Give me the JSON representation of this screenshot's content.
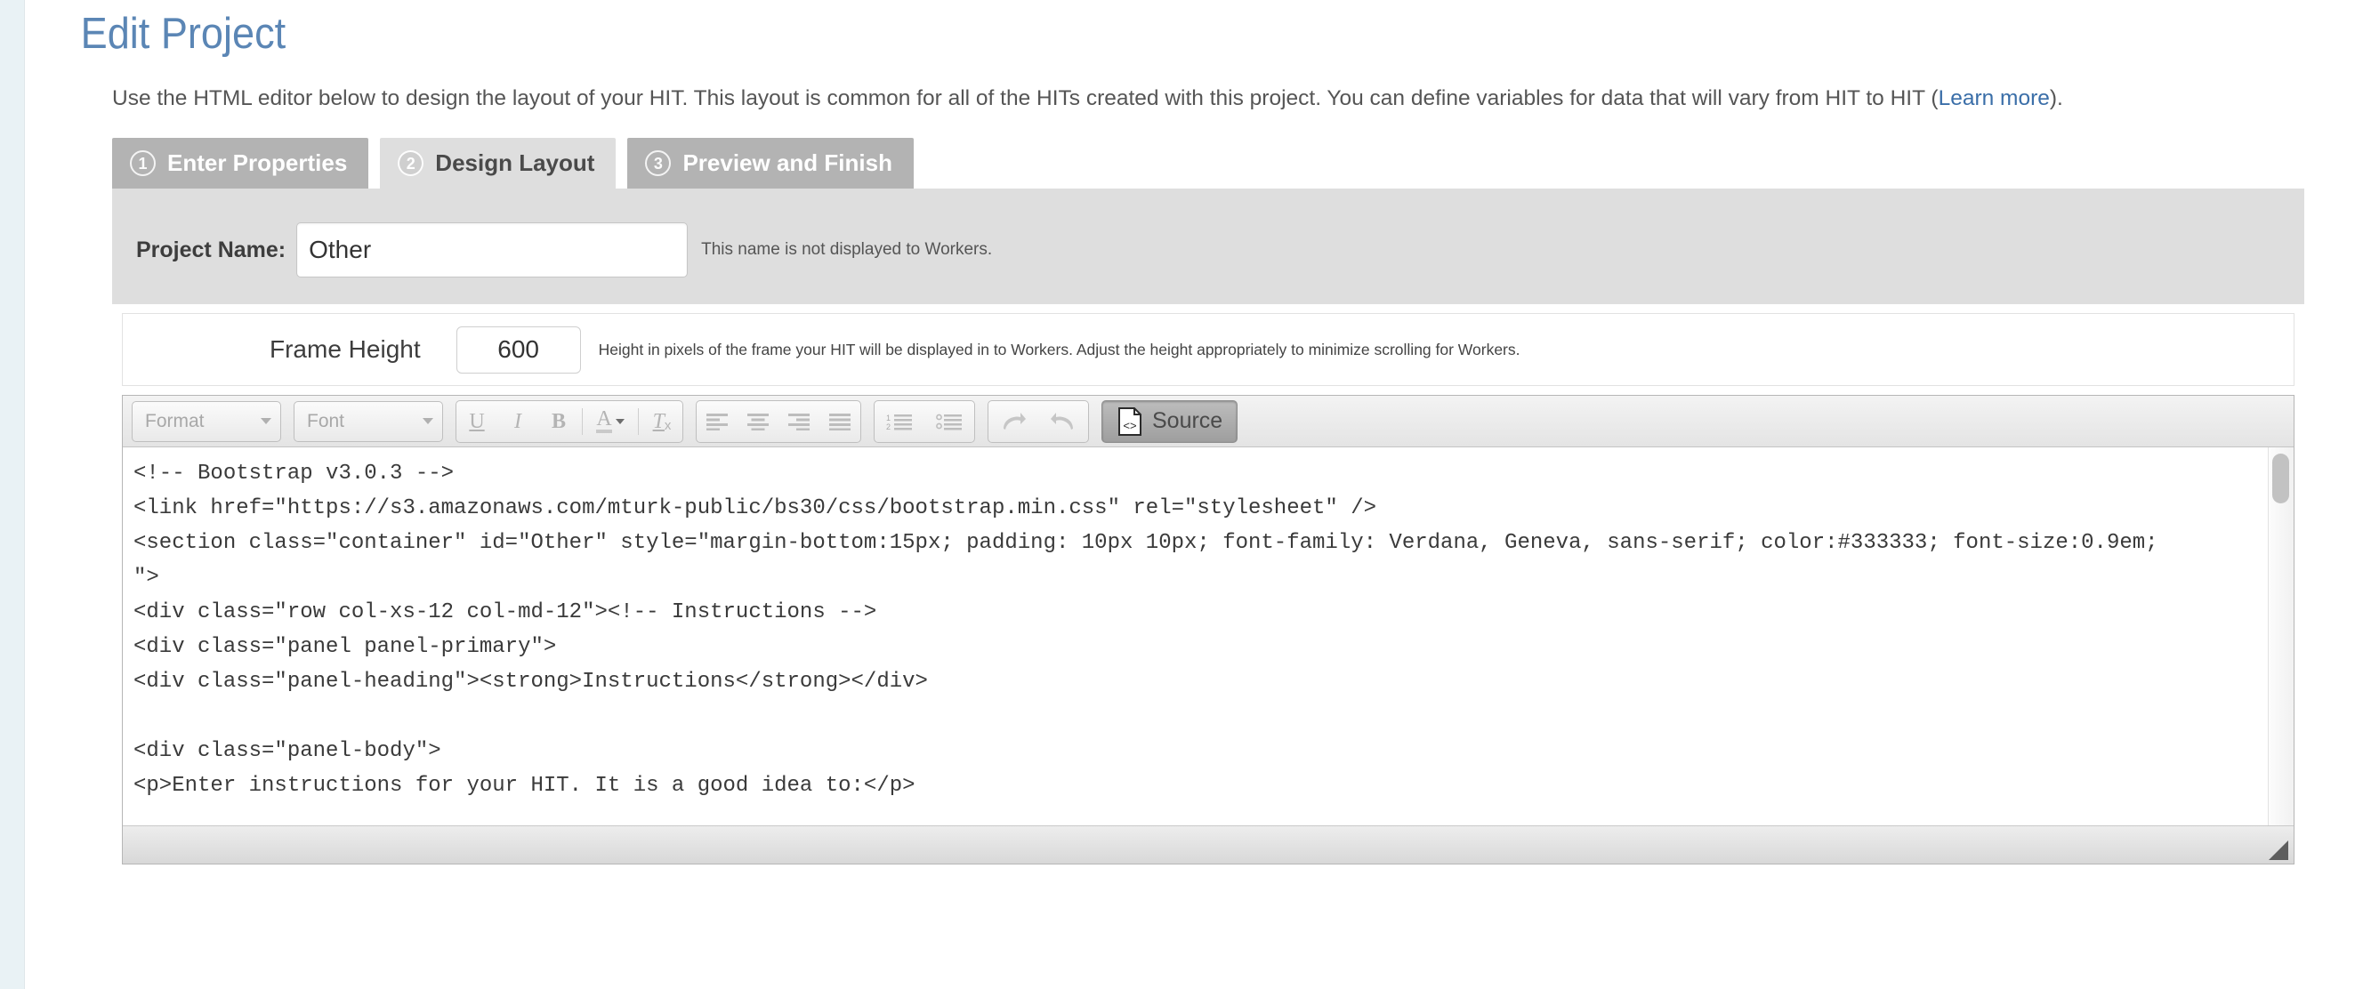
{
  "page": {
    "title": "Edit Project",
    "description_part1": "Use the HTML editor below to design the layout of your HIT. This layout is common for all of the HITs created with this project. You can define variables for data that will vary from HIT to HIT (",
    "description_link": "Learn more",
    "description_part2": ")."
  },
  "tabs": [
    {
      "number": "1",
      "label": "Enter Properties",
      "active": false
    },
    {
      "number": "2",
      "label": "Design Layout",
      "active": true
    },
    {
      "number": "3",
      "label": "Preview and Finish",
      "active": false
    }
  ],
  "properties": {
    "project_name_label": "Project Name:",
    "project_name_value": "Other",
    "project_name_placeholder": "Project Name",
    "project_name_help": "This name is not displayed to Workers."
  },
  "frame": {
    "label": "Frame Height",
    "value": "600",
    "placeholder": "600",
    "help": "Height in pixels of the frame your HIT will be displayed in to Workers. Adjust the height appropriately to minimize scrolling for Workers."
  },
  "toolbar": {
    "format_label": "Format",
    "font_label": "Font",
    "underline_label": "U",
    "italic_label": "I",
    "bold_label": "B",
    "text_color_label": "A",
    "remove_format_label": "Tx",
    "source_label": "Source"
  },
  "editor": {
    "source_code": "<!-- Bootstrap v3.0.3 -->\n<link href=\"https://s3.amazonaws.com/mturk-public/bs30/css/bootstrap.min.css\" rel=\"stylesheet\" />\n<section class=\"container\" id=\"Other\" style=\"margin-bottom:15px; padding: 10px 10px; font-family: Verdana, Geneva, sans-serif; color:#333333; font-size:0.9em;\n\">\n<div class=\"row col-xs-12 col-md-12\"><!-- Instructions -->\n<div class=\"panel panel-primary\">\n<div class=\"panel-heading\"><strong>Instructions</strong></div>\n\n<div class=\"panel-body\">\n<p>Enter instructions for your HIT. It is a good idea to:</p>"
  },
  "colors": {
    "title_blue": "#5b86b5",
    "link_blue": "#3a6ea8",
    "tab_inactive": "#b3b3b3",
    "tab_active": "#dedede",
    "panel_gray": "#dedede"
  }
}
